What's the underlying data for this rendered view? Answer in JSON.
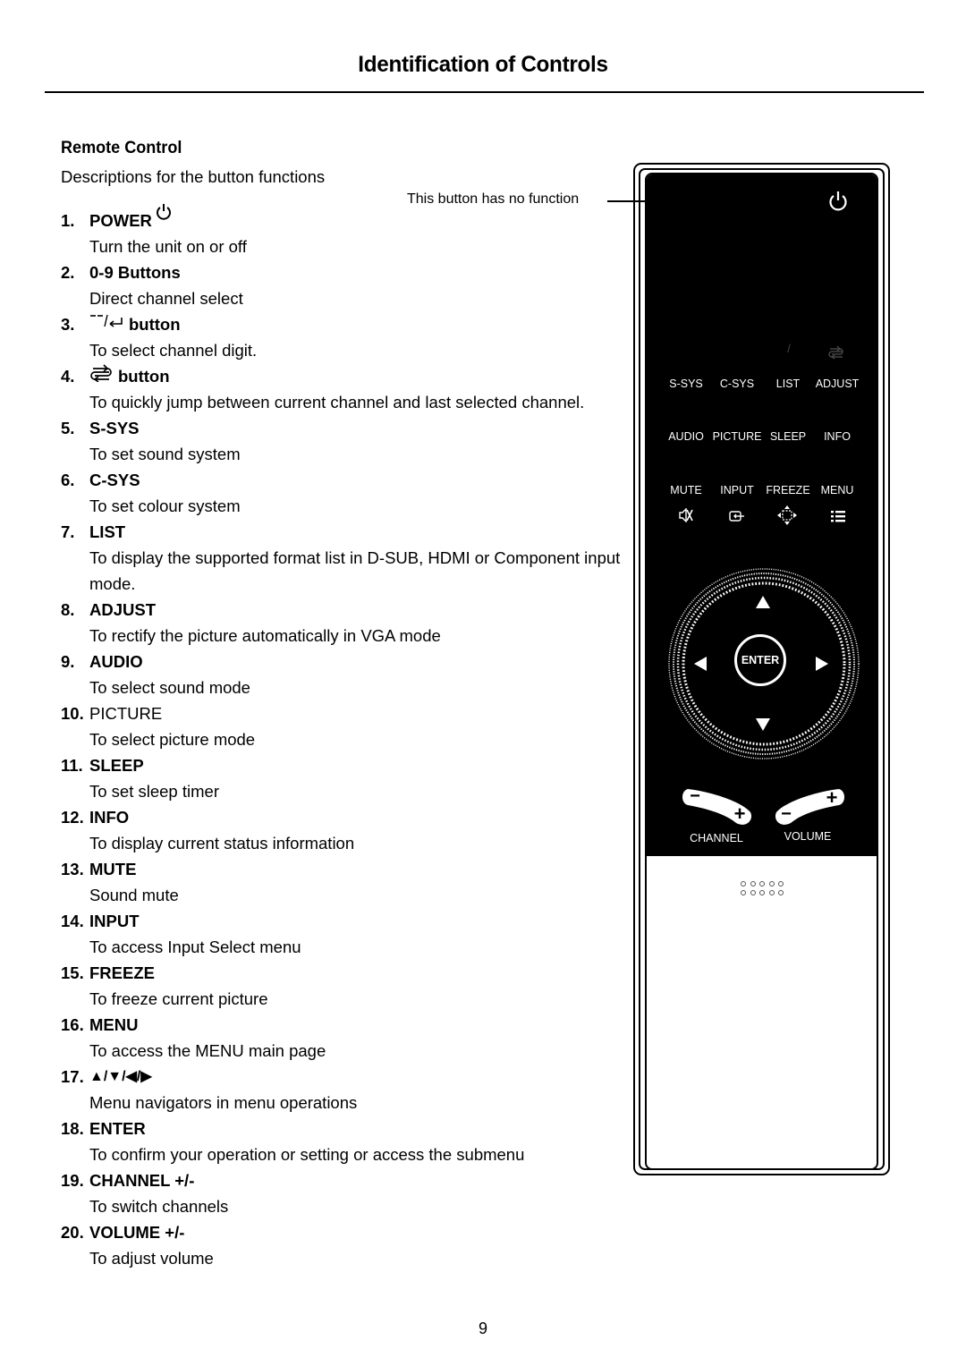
{
  "page": {
    "title": "Identification of Controls",
    "section_heading": "Remote Control",
    "intro": "Descriptions for the button functions",
    "page_number": "9"
  },
  "items": [
    {
      "number": "1.",
      "name": "POWER",
      "icon": "power-icon",
      "description": "Turn the unit on or off"
    },
    {
      "number": "2.",
      "name": "0-9 Buttons",
      "description": "Direct channel select"
    },
    {
      "number": "3.",
      "name": "button",
      "icon": "dash-return-icon",
      "icon_text": "--/↵",
      "description": "To select channel digit."
    },
    {
      "number": "4.",
      "name": "button",
      "icon": "swap-icon",
      "description": "To quickly jump between current channel and last selected channel."
    },
    {
      "number": "5.",
      "name": "S-SYS",
      "description": "To set sound system"
    },
    {
      "number": "6.",
      "name": "C-SYS",
      "description": "To set colour system"
    },
    {
      "number": "7.",
      "name": "LIST",
      "description": "To display the supported format list in D-SUB, HDMI or Component input mode."
    },
    {
      "number": "8.",
      "name": "ADJUST",
      "description": "To rectify the picture automatically in VGA mode"
    },
    {
      "number": "9.",
      "name": "AUDIO",
      "description": "To select sound mode"
    },
    {
      "number": "10.",
      "name": "PICTURE",
      "description": "To select picture mode"
    },
    {
      "number": "11.",
      "name": "SLEEP",
      "description": "To set sleep timer"
    },
    {
      "number": "12.",
      "name": "INFO",
      "description": "To display current status information"
    },
    {
      "number": "13.",
      "name": "MUTE",
      "description": "Sound mute"
    },
    {
      "number": "14.",
      "name": "INPUT",
      "description": "To access Input Select menu"
    },
    {
      "number": "15.",
      "name": "FREEZE",
      "description": "To freeze current picture"
    },
    {
      "number": "16.",
      "name": "MENU",
      "description": "To access the MENU main page"
    },
    {
      "number": "17.",
      "name": "▲/▼/◀/▶",
      "description": "Menu navigators in menu operations"
    },
    {
      "number": "18.",
      "name": "ENTER",
      "description": "To confirm your operation or setting or access the submenu"
    },
    {
      "number": "19.",
      "name": "CHANNEL +/-",
      "description": "To switch channels"
    },
    {
      "number": "20.",
      "name": "VOLUME +/-",
      "description": "To adjust volume"
    }
  ],
  "remote": {
    "note": "This button has no function",
    "row1": [
      "S-SYS",
      "C-SYS",
      "LIST",
      "ADJUST"
    ],
    "row2": [
      "AUDIO",
      "PICTURE",
      "SLEEP",
      "INFO"
    ],
    "row3": [
      "MUTE",
      "INPUT",
      "FREEZE",
      "MENU"
    ],
    "enter_label": "ENTER",
    "channel_label": "CHANNEL",
    "volume_label": "VOLUME",
    "slash": "/",
    "minus": "−",
    "plus": "+"
  }
}
